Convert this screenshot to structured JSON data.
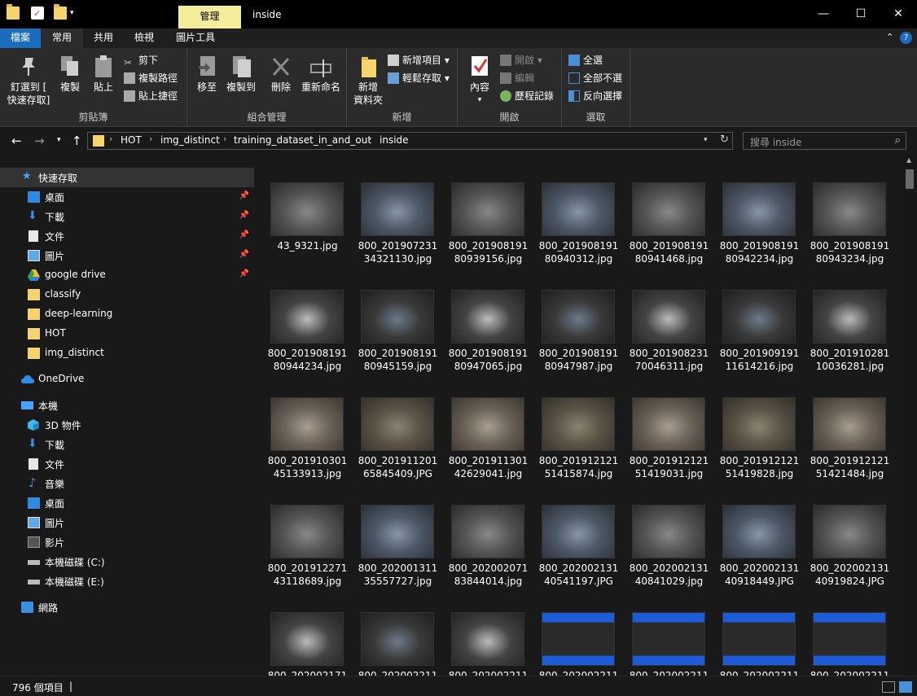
{
  "window": {
    "title": "inside",
    "context_tab": "管理",
    "minimize": "—",
    "maximize": "☐",
    "close": "✕"
  },
  "ribbon_tabs": [
    {
      "label": "檔案"
    },
    {
      "label": "常用"
    },
    {
      "label": "共用"
    },
    {
      "label": "檢視"
    },
    {
      "label": "圖片工具"
    }
  ],
  "ribbon": {
    "clipboard": {
      "group": "剪貼簿",
      "pin_line1": "釘選到 [",
      "pin_line2": "快速存取]",
      "copy": "複製",
      "paste": "貼上",
      "cut": "剪下",
      "copy_path": "複製路徑",
      "paste_shortcut": "貼上捷徑"
    },
    "organize": {
      "group": "組合管理",
      "move_to": "移至",
      "copy_to": "複製到",
      "delete": "刪除",
      "rename": "重新命名"
    },
    "new": {
      "group": "新增",
      "new_folder_line1": "新增",
      "new_folder_line2": "資料夾",
      "new_item": "新增項目",
      "easy_access": "輕鬆存取"
    },
    "open": {
      "group": "開啟",
      "properties": "內容",
      "open": "開啟",
      "edit": "編輯",
      "history": "歷程記錄"
    },
    "select": {
      "group": "選取",
      "select_all": "全選",
      "select_none": "全部不選",
      "invert": "反向選擇"
    }
  },
  "address": {
    "crumbs": [
      "HOT",
      "img_distinct",
      "training_dataset_in_and_out",
      "inside"
    ],
    "search_placeholder": "搜尋 inside"
  },
  "sidebar": {
    "quick_access": "快速存取",
    "quick_items": [
      "桌面",
      "下載",
      "文件",
      "圖片",
      "google drive",
      "classify",
      "deep-learning",
      "HOT",
      "img_distinct"
    ],
    "onedrive": "OneDrive",
    "this_pc": "本機",
    "pc_items": [
      "3D 物件",
      "下載",
      "文件",
      "音樂",
      "桌面",
      "圖片",
      "影片",
      "本機磁碟 (C:)",
      "本機磁碟 (E:)"
    ],
    "network": "網路"
  },
  "files": [
    {
      "l1": "43_9321.jpg",
      "l2": ""
    },
    {
      "l1": "800_201907231",
      "l2": "34321130.jpg"
    },
    {
      "l1": "800_201908191",
      "l2": "80939156.jpg"
    },
    {
      "l1": "800_201908191",
      "l2": "80940312.jpg"
    },
    {
      "l1": "800_201908191",
      "l2": "80941468.jpg"
    },
    {
      "l1": "800_201908191",
      "l2": "80942234.jpg"
    },
    {
      "l1": "800_201908191",
      "l2": "80943234.jpg"
    },
    {
      "l1": "800_201908191",
      "l2": "80944234.jpg"
    },
    {
      "l1": "800_201908191",
      "l2": "80945159.jpg"
    },
    {
      "l1": "800_201908191",
      "l2": "80947065.jpg"
    },
    {
      "l1": "800_201908191",
      "l2": "80947987.jpg"
    },
    {
      "l1": "800_201908231",
      "l2": "70046311.jpg"
    },
    {
      "l1": "800_201909191",
      "l2": "11614216.jpg"
    },
    {
      "l1": "800_201910281",
      "l2": "10036281.jpg"
    },
    {
      "l1": "800_201910301",
      "l2": "45133913.jpg"
    },
    {
      "l1": "800_201911201",
      "l2": "65845409.JPG"
    },
    {
      "l1": "800_201911301",
      "l2": "42629041.jpg"
    },
    {
      "l1": "800_201912121",
      "l2": "51415874.jpg"
    },
    {
      "l1": "800_201912121",
      "l2": "51419031.jpg"
    },
    {
      "l1": "800_201912121",
      "l2": "51419828.jpg"
    },
    {
      "l1": "800_201912121",
      "l2": "51421484.jpg"
    },
    {
      "l1": "800_201912271",
      "l2": "43118689.jpg"
    },
    {
      "l1": "800_202001311",
      "l2": "35557727.jpg"
    },
    {
      "l1": "800_202002071",
      "l2": "83844014.jpg"
    },
    {
      "l1": "800_202002131",
      "l2": "40541197.JPG"
    },
    {
      "l1": "800_202002131",
      "l2": "40841029.jpg"
    },
    {
      "l1": "800_202002131",
      "l2": "40918449.JPG"
    },
    {
      "l1": "800_202002131",
      "l2": "40919824.JPG"
    },
    {
      "l1": "800_202002171",
      "l2": ""
    },
    {
      "l1": "800_202002211",
      "l2": ""
    },
    {
      "l1": "800_202002211",
      "l2": ""
    },
    {
      "l1": "800_202002211",
      "l2": ""
    },
    {
      "l1": "800_202002211",
      "l2": ""
    },
    {
      "l1": "800_202002211",
      "l2": ""
    },
    {
      "l1": "800_202002211",
      "l2": ""
    }
  ],
  "status": {
    "count": "796 個項目",
    "separator": "|"
  },
  "colors": {
    "file_tab": "#1a6dbd",
    "context_tab": "#f5ec9b",
    "folder": "#f7d36b",
    "ribbon_bg": "#2b2b2b",
    "bg": "#191919"
  }
}
